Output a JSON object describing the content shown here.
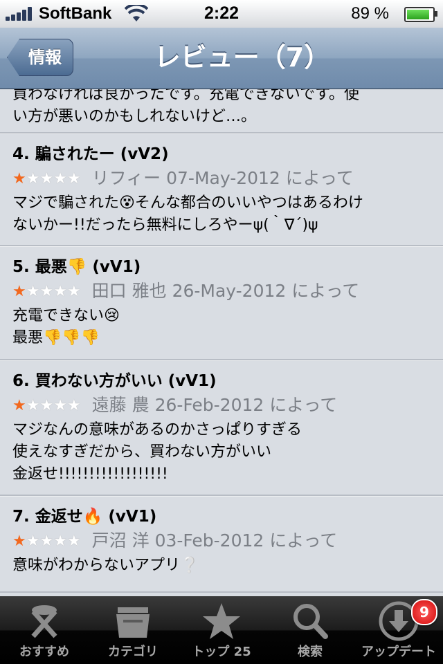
{
  "statusbar": {
    "carrier": "SoftBank",
    "time": "2:22",
    "battery_pct": "89 %",
    "battery_level": 0.89
  },
  "navbar": {
    "back_label": "情報",
    "title": "レビュー（7）"
  },
  "reviews": [
    {
      "title": "",
      "meta": "",
      "lines": [
        "買わなければ良かったです。充電できないです。使",
        "い方が悪いのかもしれないけど…。"
      ]
    },
    {
      "title": "4. 騙されたー (vV2)",
      "stars": 1,
      "meta": "リフィー 07-May-2012 によって",
      "lines": [
        "マジで騙された😵そんな都合のいいやつはあるわけ",
        "ないかー!!だったら無料にしろやーψ(｀∇´)ψ"
      ]
    },
    {
      "title": "5. 最悪👎 (vV1)",
      "stars": 1,
      "meta": "田口 雅也 26-May-2012 によって",
      "lines": [
        "充電できない😢",
        "最悪👎👎👎"
      ]
    },
    {
      "title": "6. 買わない方がいい (vV1)",
      "stars": 1,
      "meta": "遠藤 農 26-Feb-2012 によって",
      "lines": [
        "マジなんの意味があるのかさっぱりすぎる",
        "使えなすぎだから、買わない方がいい",
        "金返せ!!!!!!!!!!!!!!!!!!"
      ]
    },
    {
      "title": "7. 金返せ🔥 (vV1)",
      "stars": 1,
      "meta": "戸沼 洋 03-Feb-2012 によって",
      "lines": [
        "意味がわからないアプリ❔"
      ]
    }
  ],
  "tabbar": {
    "tabs": [
      {
        "label": "おすすめ",
        "icon": "featured-icon"
      },
      {
        "label": "カテゴリ",
        "icon": "categories-icon"
      },
      {
        "label": "トップ 25",
        "icon": "star-icon"
      },
      {
        "label": "検索",
        "icon": "search-icon"
      },
      {
        "label": "アップデート",
        "icon": "download-icon",
        "badge": "9"
      }
    ]
  },
  "colors": {
    "star_on": "#f2681e",
    "star_off": "#ffffff",
    "badge": "#d20a0a"
  }
}
